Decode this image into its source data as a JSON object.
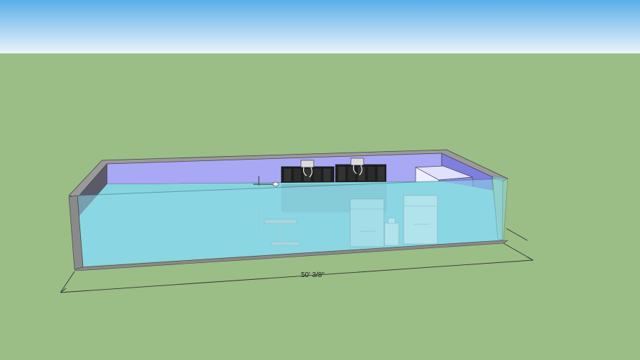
{
  "viewport": {
    "dimension_label": "50' 3/8\""
  },
  "colors": {
    "sky_top": "#5aaee8",
    "sky_bottom": "#eaf4fb",
    "ground": "#9bbd86",
    "back_wall": "#a9a8f4",
    "glass_front": "#8fd8e6",
    "wall_top": "#9a9a9a",
    "equipment": "#1e1e1e"
  }
}
